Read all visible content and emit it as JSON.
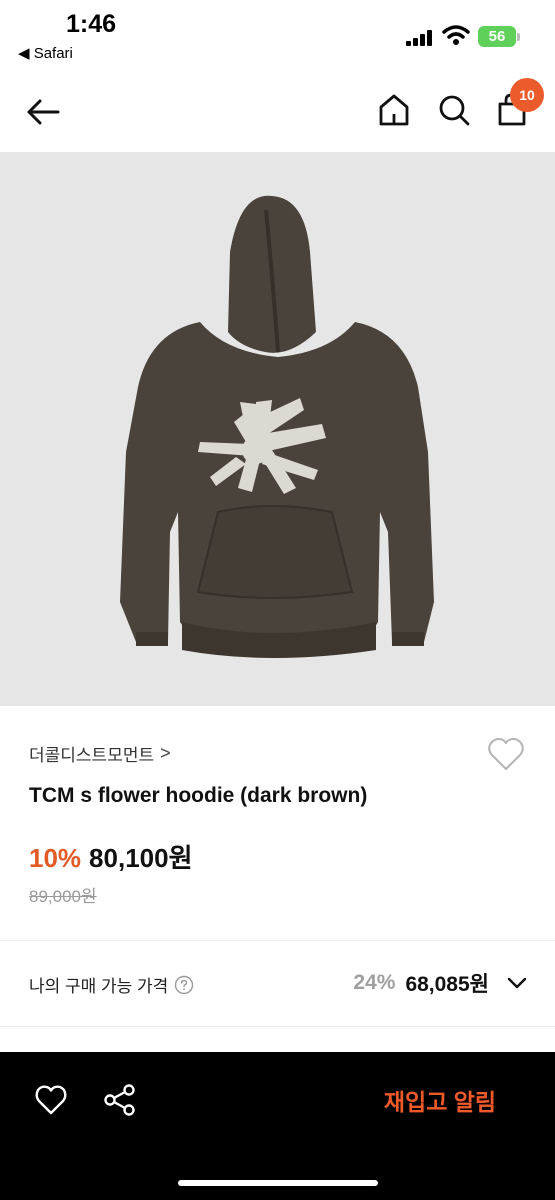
{
  "status_bar": {
    "time": "1:46",
    "back_app": "◀ Safari",
    "battery": "56"
  },
  "nav": {
    "cart_count": "10",
    "icons": [
      "back-arrow-icon",
      "home-icon",
      "search-icon",
      "cart-icon"
    ]
  },
  "product": {
    "brand": "더콜디스트모먼트",
    "brand_chevron": ">",
    "title": "TCM s flower hoodie (dark brown)",
    "discount_rate": "10%",
    "sale_price": "80,100원",
    "original_price": "89,000원"
  },
  "my_price": {
    "label": "나의 구매 가능 가격",
    "rate": "24%",
    "price": "68,085원"
  },
  "bottom_bar": {
    "restock_label": "재입고 알림"
  },
  "colors": {
    "accent": "#e25a26",
    "badge": "#ec5b2b",
    "image_bg": "#e6e6e6",
    "hoodie": "#4a433c"
  }
}
